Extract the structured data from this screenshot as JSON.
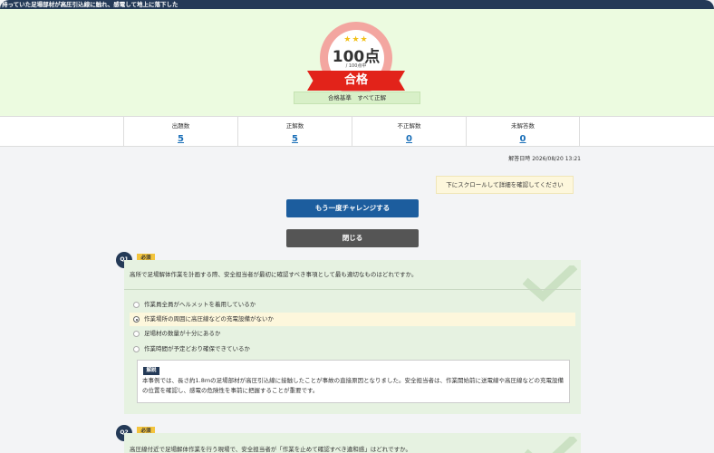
{
  "topbar": {
    "title": "持っていた足場部材が高圧引込線に触れ、感電して地上に落下した"
  },
  "result": {
    "stars": "★★★",
    "score": "100点",
    "score_sub": "/ 100点中",
    "status": "合格",
    "criteria": "合格基準　すべて正解"
  },
  "stats": [
    {
      "label": "出題数",
      "value": "5"
    },
    {
      "label": "正解数",
      "value": "5"
    },
    {
      "label": "不正解数",
      "value": "0"
    },
    {
      "label": "未解答数",
      "value": "0"
    }
  ],
  "answered_at": "解答日時 2026/08/20 13:21",
  "hint": "下にスクロールして詳細を確認してください",
  "buttons": {
    "retry": "もう一度チャレンジする",
    "close": "閉じる"
  },
  "colors": {
    "navy": "#243a57",
    "hero_bg": "#ecfbe0",
    "ribbon": "#e2231a",
    "link": "#1a6fb8",
    "retry": "#1c5d9e",
    "close": "#555555",
    "question_bg": "#e6f2e1",
    "selected": "#fdf7dc"
  },
  "questions": [
    {
      "number": "Q1",
      "required": "必須",
      "text": "高所で足場解体作業を計画する際、安全担当者が最初に確認すべき事項として最も適切なものはどれですか。",
      "options": [
        {
          "label": "作業員全員がヘルメットを着用しているか",
          "selected": false
        },
        {
          "label": "作業場所の周囲に高圧線などの充電設備がないか",
          "selected": true
        },
        {
          "label": "足場材の数量が十分にあるか",
          "selected": false
        },
        {
          "label": "作業時間が予定どおり確保できているか",
          "selected": false
        }
      ],
      "explanation_tag": "解説",
      "explanation": "本事例では、長さ約1.8mの足場部材が高圧引込線に接触したことが事故の直接原因となりました。安全担当者は、作業開始前に送電線や高圧線などの充電設備の位置を確認し、感電の危険性を事前に把握することが重要です。"
    },
    {
      "number": "Q2",
      "required": "必須",
      "text": "高圧線付近で足場解体作業を行う現場で、安全担当者が「作業を止めて確認すべき違和感」はどれですか。"
    }
  ]
}
